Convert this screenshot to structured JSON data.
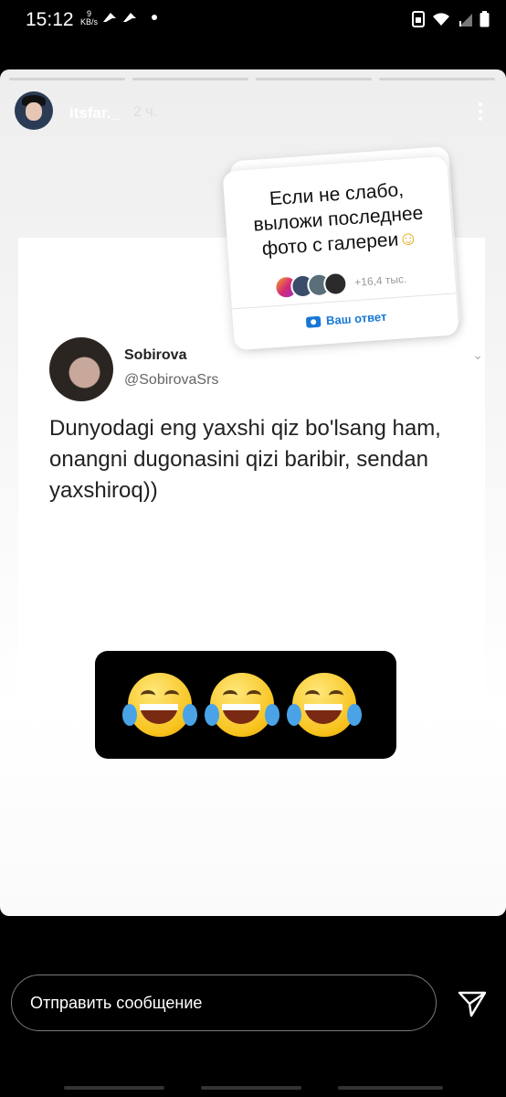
{
  "status_bar": {
    "time": "15:12",
    "speed_value": "9",
    "speed_unit": "KB/s",
    "icons": [
      "tiktok-icon",
      "tiktok-icon",
      "dot-icon",
      "sim-icon",
      "wifi-icon",
      "signal-icon",
      "battery-icon"
    ]
  },
  "story": {
    "segments": 4,
    "username": "itsfar._",
    "time_ago": "2 ч.",
    "question": {
      "text": "Если не слабо, выложи последнее фото с галереи",
      "emoji": "☺",
      "responder_count": "+16,4 тыс.",
      "answer_label": "Ваш ответ"
    },
    "tweet": {
      "name": "Sobirova",
      "handle": "@SobirovaSrs",
      "text": "Dunyodagi eng yaxshi qiz bo'lsang ham, onangni dugonasini qizi baribir, sendan yaxshiroq))"
    },
    "emoji_icons": [
      "laughing-tears-icon",
      "laughing-tears-icon",
      "laughing-tears-icon"
    ]
  },
  "footer": {
    "message_placeholder": "Отправить сообщение"
  },
  "colors": {
    "accent_blue": "#1877d6",
    "background": "#000000"
  }
}
